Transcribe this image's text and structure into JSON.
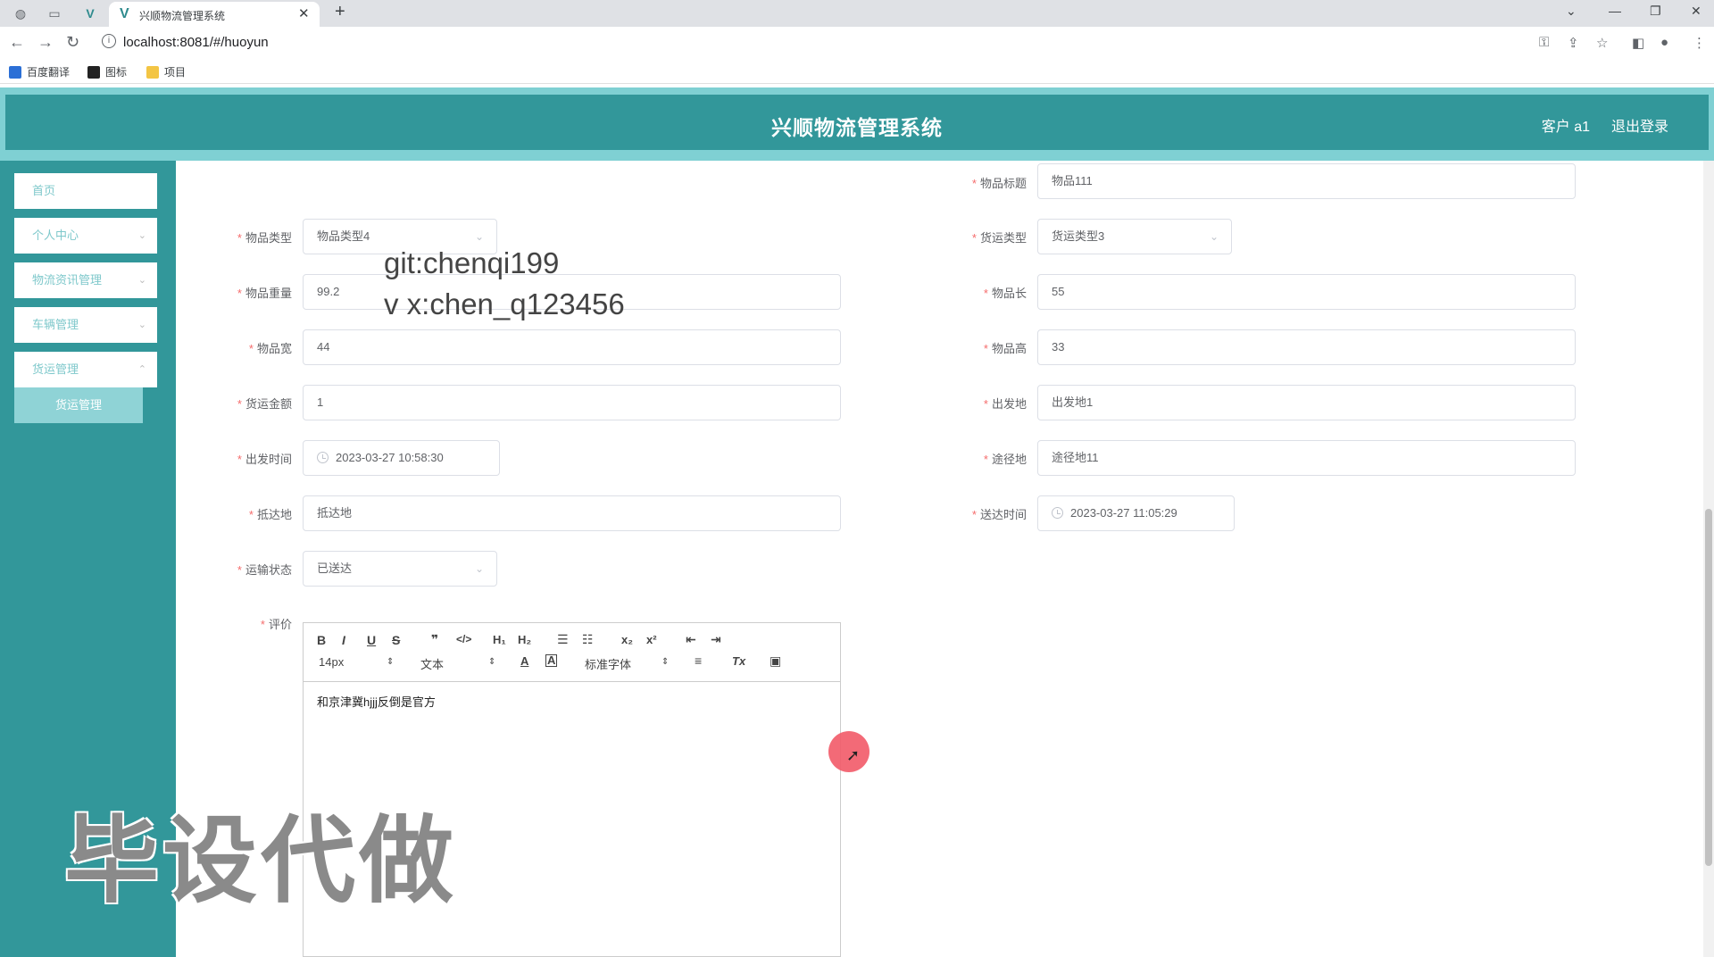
{
  "browser": {
    "tab_title": "兴顺物流管理系统",
    "url": "localhost:8081/#/huoyun",
    "bookmarks": [
      "百度翻译",
      "图标",
      "项目"
    ]
  },
  "header": {
    "title": "兴顺物流管理系统",
    "user": "客户 a1",
    "logout": "退出登录"
  },
  "sidebar": {
    "items": [
      {
        "label": "首页"
      },
      {
        "label": "个人中心"
      },
      {
        "label": "物流资讯管理"
      },
      {
        "label": "车辆管理"
      },
      {
        "label": "货运管理"
      }
    ],
    "submenu": "货运管理"
  },
  "form": {
    "item_title": {
      "label": "物品标题",
      "value": "物品111"
    },
    "item_type": {
      "label": "物品类型",
      "value": "物品类型4"
    },
    "freight_type": {
      "label": "货运类型",
      "value": "货运类型3"
    },
    "weight": {
      "label": "物品重量",
      "value": "99.2"
    },
    "length": {
      "label": "物品长",
      "value": "55"
    },
    "width": {
      "label": "物品宽",
      "value": "44"
    },
    "height": {
      "label": "物品高",
      "value": "33"
    },
    "amount": {
      "label": "货运金额",
      "value": "1"
    },
    "origin": {
      "label": "出发地",
      "value": "出发地1"
    },
    "depart_time": {
      "label": "出发时间",
      "value": "2023-03-27 10:58:30"
    },
    "waypoint": {
      "label": "途径地",
      "value": "途径地11"
    },
    "destination": {
      "label": "抵达地",
      "value": "抵达地"
    },
    "arrive_time": {
      "label": "送达时间",
      "value": "2023-03-27 11:05:29"
    },
    "status": {
      "label": "运输状态",
      "value": "已送达"
    },
    "review": {
      "label": "评价",
      "content": "和京津冀hjjj反倒是官方"
    }
  },
  "editor": {
    "font_size": "14px",
    "format": "文本",
    "font": "标准字体"
  },
  "overlay": {
    "watermark_line1": "git:chenqi199",
    "watermark_line2": "v x:chen_q123456",
    "watermark_big": "毕设代做"
  }
}
